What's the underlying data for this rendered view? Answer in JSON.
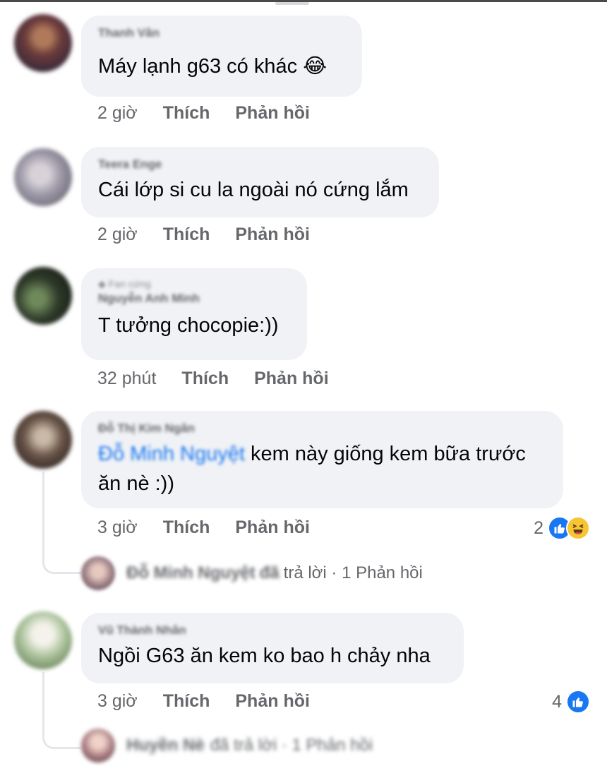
{
  "comments": [
    {
      "author": "Thanh Vân",
      "text": "Máy lạnh g63 có khác",
      "emoji": "😂",
      "time": "2 giờ",
      "like": "Thích",
      "reply": "Phản hồi"
    },
    {
      "author": "Teera Enge",
      "text": "Cái lớp si cu la ngoài nó cứng lắm",
      "time": "2 giờ",
      "like": "Thích",
      "reply": "Phản hồi"
    },
    {
      "badge": "Fan cứng",
      "author": "Nguyễn Anh Minh",
      "text": "T tưởng chocopie:))",
      "time": "32 phút",
      "like": "Thích",
      "reply": "Phản hồi"
    },
    {
      "author": "Đỗ Thị Kim Ngân",
      "mention": "Đỗ Minh Nguyệt",
      "text_line1": "kem này giống kem bữa trước",
      "text_line2": "ăn nè :))",
      "time": "3 giờ",
      "like": "Thích",
      "reply": "Phản hồi",
      "reaction_count": "2",
      "reactions": [
        "like-icon",
        "haha-icon"
      ],
      "reply_author": "Đỗ Minh Nguyệt",
      "reply_word_blur": "đã",
      "reply_summary": "trả lời · 1 Phản hồi"
    },
    {
      "author": "Vũ Thành Nhân",
      "text": "Ngồi G63 ăn kem ko bao h chảy nha",
      "time": "3 giờ",
      "like": "Thích",
      "reply": "Phản hồi",
      "reaction_count": "4",
      "reactions": [
        "like-icon"
      ],
      "reply_author": "Huyền Nè",
      "reply_summary": "đã trả lời · 1 Phản hồi"
    }
  ],
  "colors": {
    "bubble": "#f0f2f5",
    "meta": "#65676b",
    "like_blue": "#1877f2",
    "haha_yellow": "#f7c533"
  }
}
